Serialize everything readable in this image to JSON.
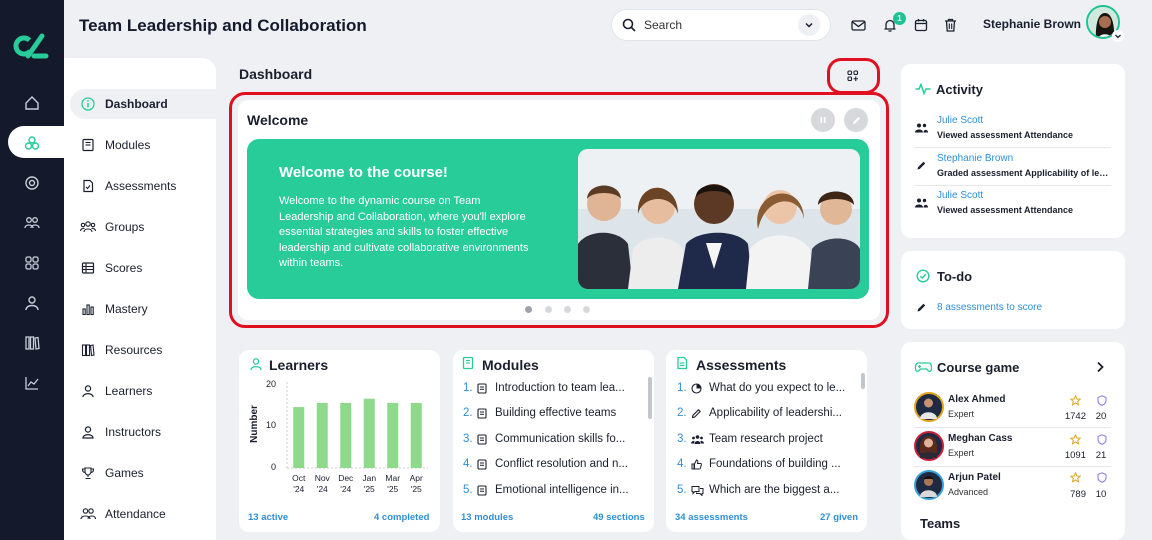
{
  "app": {
    "title": "Team Leadership and Collaboration"
  },
  "header": {
    "search_placeholder": "Search",
    "notification_count": "1",
    "user_name": "Stephanie Brown"
  },
  "rail": {
    "icons": [
      "home-icon",
      "courses-icon",
      "target-icon",
      "users-icon",
      "grid-icon",
      "person-icon",
      "library-icon",
      "chart-icon"
    ]
  },
  "subnav": {
    "items": [
      {
        "label": "Dashboard",
        "icon": "info-icon",
        "active": true
      },
      {
        "label": "Modules",
        "icon": "book-icon"
      },
      {
        "label": "Assessments",
        "icon": "assessment-icon"
      },
      {
        "label": "Groups",
        "icon": "groups-icon"
      },
      {
        "label": "Scores",
        "icon": "scores-icon"
      },
      {
        "label": "Mastery",
        "icon": "bars-icon"
      },
      {
        "label": "Resources",
        "icon": "resources-icon"
      },
      {
        "label": "Learners",
        "icon": "learner-icon"
      },
      {
        "label": "Instructors",
        "icon": "instructor-icon"
      },
      {
        "label": "Games",
        "icon": "trophy-icon"
      },
      {
        "label": "Attendance",
        "icon": "attendance-icon"
      }
    ]
  },
  "dashboard": {
    "title": "Dashboard",
    "welcome": {
      "title": "Welcome",
      "banner_heading": "Welcome to the course!",
      "banner_text": "Welcome to the dynamic course on Team Leadership and Collaboration, where you'll explore essential strategies and skills to foster effective leadership and cultivate collaborative environments within teams.",
      "slides": 4,
      "active_slide": 1
    }
  },
  "learners": {
    "title": "Learners",
    "footer_left": "13 active",
    "footer_right": "4 completed",
    "chart_data": {
      "type": "bar",
      "ylabel": "Number",
      "ylim": [
        0,
        20
      ],
      "yticks": [
        "20",
        "10",
        "0"
      ],
      "categories": [
        "Oct '24",
        "Nov '24",
        "Dec '24",
        "Jan '25",
        "Mar '25",
        "Apr '25"
      ],
      "tick_top": [
        "Oct",
        "Nov",
        "Dec",
        "Jan",
        "Mar",
        "Apr"
      ],
      "tick_bottom": [
        "'24",
        "'24",
        "'24",
        "'25",
        "'25",
        "'25"
      ],
      "values": [
        14.5,
        15.5,
        15.5,
        16.5,
        15.5,
        15.5
      ],
      "color": "#8fd98a"
    }
  },
  "modules": {
    "title": "Modules",
    "items": [
      {
        "num": "1.",
        "text": "Introduction to team lea..."
      },
      {
        "num": "2.",
        "text": "Building effective teams"
      },
      {
        "num": "3.",
        "text": "Communication skills fo..."
      },
      {
        "num": "4.",
        "text": "Conflict resolution and n..."
      },
      {
        "num": "5.",
        "text": "Emotional intelligence in..."
      }
    ],
    "footer_left": "13 modules",
    "footer_right": "49 sections"
  },
  "assessments": {
    "title": "Assessments",
    "items": [
      {
        "num": "1.",
        "text": "What do you expect to le...",
        "icon": "pie-icon"
      },
      {
        "num": "2.",
        "text": "Applicability of leadershi...",
        "icon": "pencil-icon"
      },
      {
        "num": "3.",
        "text": "Team research project",
        "icon": "team-icon"
      },
      {
        "num": "4.",
        "text": "Foundations of building ...",
        "icon": "thumb-icon"
      },
      {
        "num": "5.",
        "text": "Which are the biggest a...",
        "icon": "chat-icon"
      }
    ],
    "footer_left": "34 assessments",
    "footer_right": "27 given"
  },
  "activity": {
    "title": "Activity",
    "items": [
      {
        "name": "Julie Scott",
        "desc": "Viewed assessment Attendance",
        "icon": "users-icon"
      },
      {
        "name": "Stephanie Brown",
        "desc": "Graded assessment Applicability of leadership",
        "icon": "pencil-icon"
      },
      {
        "name": "Julie Scott",
        "desc": "Viewed assessment Attendance",
        "icon": "users-icon"
      }
    ]
  },
  "todo": {
    "title": "To-do",
    "item": "8 assessments to score"
  },
  "course_game": {
    "title": "Course game",
    "players": [
      {
        "name": "Alex Ahmed",
        "level": "Expert",
        "points": "1742",
        "badges": "20"
      },
      {
        "name": "Meghan Cass",
        "level": "Expert",
        "points": "1091",
        "badges": "21"
      },
      {
        "name": "Arjun Patel",
        "level": "Advanced",
        "points": "789",
        "badges": "10"
      }
    ],
    "teams_title": "Teams"
  },
  "colors": {
    "accent": "#27cc99",
    "rail": "#141a2b",
    "link": "#2f8fd6",
    "highlight": "#e01020"
  }
}
